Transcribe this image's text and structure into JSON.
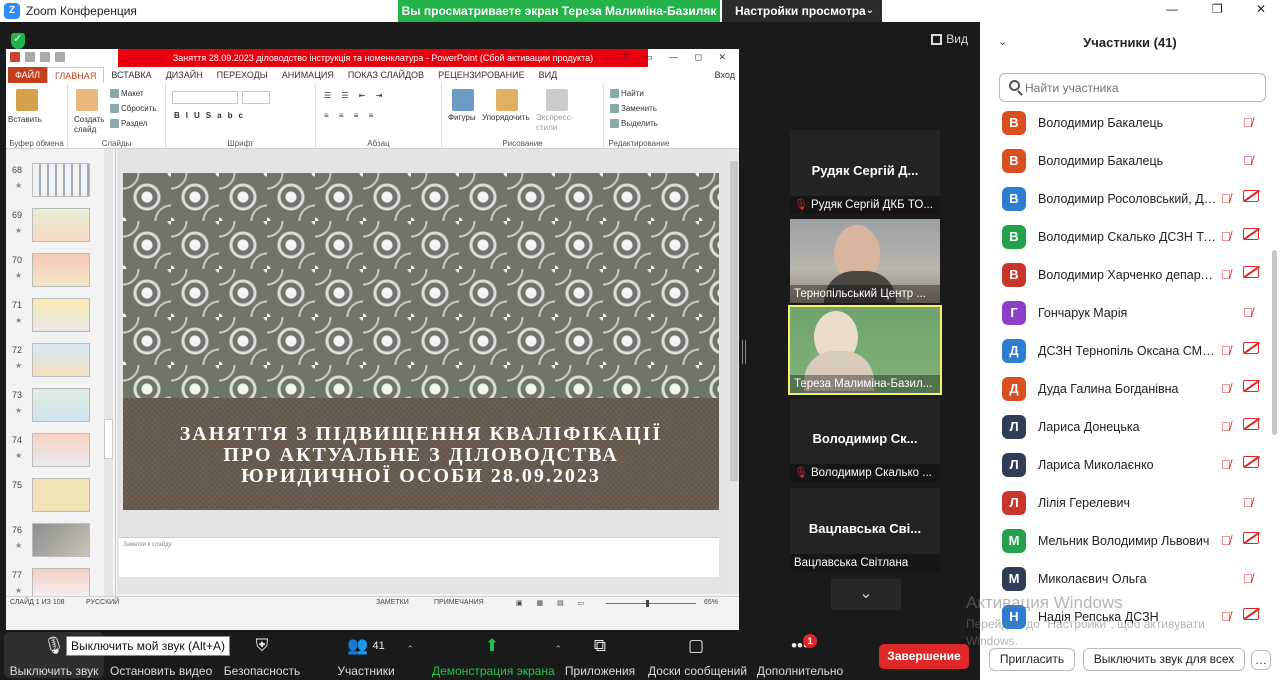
{
  "window": {
    "title": "Zoom Конференция",
    "share_banner": "Вы просматриваете экран Тереза Малиміна-Базиляк",
    "view_options": "Настройки просмотра",
    "view_button": "Вид"
  },
  "ppt": {
    "title": "Заняття 28.09.2023 діловодство інструкція та номенклатура - PowerPoint (Сбой активации продукта)",
    "tabs": [
      "ФАЙЛ",
      "ГЛАВНАЯ",
      "ВСТАВКА",
      "ДИЗАЙН",
      "ПЕРЕХОДЫ",
      "АНИМАЦИЯ",
      "ПОКАЗ СЛАЙДОВ",
      "РЕЦЕНЗИРОВАНИЕ",
      "ВИД"
    ],
    "user": "Вход",
    "ribbon": {
      "paste": "Вставить",
      "clipboard": "Буфер обмена",
      "new_slide": "Создать слайд",
      "layout": "Макет",
      "reset": "Сбросить",
      "section": "Раздел",
      "slides": "Слайды",
      "font": "Шрифт",
      "paragraph": "Абзац",
      "shapes": "Фигуры",
      "arrange": "Упорядочить",
      "quick_styles": "Экспресс-стили",
      "drawing": "Рисование",
      "find": "Найти",
      "replace": "Заменить",
      "select": "Выделить",
      "editing": "Редактирование"
    },
    "thumbnails": [
      "68",
      "69",
      "70",
      "71",
      "72",
      "73",
      "74",
      "75",
      "76",
      "77"
    ],
    "slide_lines": [
      "ЗАНЯТТЯ З ПІДВИЩЕННЯ КВАЛІФІКАЦІЇ",
      "ПРО АКТУАЛЬНЕ З ДІЛОВОДСТВА",
      "ЮРИДИЧНОЇ ОСОБИ 28.09.2023"
    ],
    "notes": "Заметки к слайду",
    "status": {
      "slide": "СЛАЙД 1 ИЗ 108",
      "lang": "РУССКИЙ",
      "notes": "ЗАМЕТКИ",
      "comments": "ПРИМЕЧАНИЯ",
      "zoom": "65%"
    }
  },
  "tiles": [
    {
      "big": "Рудяк Сергій Д...",
      "caption": "Рудяк Сергій ДКБ ТО...",
      "muted": true
    },
    {
      "big": "",
      "caption": "Тернопільський Центр ...",
      "muted": false
    },
    {
      "big": "",
      "caption": "Тереза Малиміна-Базил...",
      "muted": false
    },
    {
      "big": "Володимир Ск...",
      "caption": "Володимир Скалько ...",
      "muted": true
    },
    {
      "big": "Вацлавська Сві...",
      "caption": "Вацлавська Світлана",
      "muted": false
    }
  ],
  "toolbar": {
    "tooltip": "Выключить мой звук (Alt+A)",
    "mute": "Выключить звук",
    "video": "Остановить видео",
    "security": "Безопасность",
    "participants": "Участники",
    "participants_count": "41",
    "share": "Демонстрация экрана",
    "apps": "Приложения",
    "whiteboards": "Доски сообщений",
    "more": "Дополнительно",
    "more_badge": "1",
    "end": "Завершение"
  },
  "panel": {
    "title": "Участники (41)",
    "search_placeholder": "Найти участника",
    "invite": "Пригласить",
    "mute_all": "Выключить звук для всех",
    "participants": [
      {
        "initial": "В",
        "name": "Володимир Бакалець",
        "color": "#d9501e",
        "cam": false
      },
      {
        "initial": "В",
        "name": "Володимир Бакалець",
        "color": "#d9501e",
        "cam": false
      },
      {
        "initial": "В",
        "name": "Володимир Росоловський, ДС...",
        "color": "#2d7dd2",
        "cam": true
      },
      {
        "initial": "В",
        "name": "Володимир Скалько ДСЗН Те...",
        "color": "#23a24d",
        "cam": true
      },
      {
        "initial": "В",
        "name": "Володимир Харченко департа...",
        "color": "#c8352b",
        "cam": true
      },
      {
        "initial": "Г",
        "name": "Гончарук Марія",
        "color": "#8c3fc9",
        "cam": false
      },
      {
        "initial": "Д",
        "name": "ДСЗН Тернопіль Оксана СМО...",
        "color": "#2d7dd2",
        "cam": true
      },
      {
        "initial": "Д",
        "name": "Дуда Галина Богданівна",
        "color": "#d9501e",
        "cam": true
      },
      {
        "initial": "Л",
        "name": "Лариса Донецька",
        "color": "#2f3e56",
        "cam": true
      },
      {
        "initial": "Л",
        "name": "Лариса Миколаєнко",
        "color": "#2f3e56",
        "cam": true
      },
      {
        "initial": "Л",
        "name": "Лілія Герелевич",
        "color": "#c8352b",
        "cam": false
      },
      {
        "initial": "М",
        "name": "Мельник Володимир Львович",
        "color": "#23a24d",
        "cam": true
      },
      {
        "initial": "М",
        "name": "Миколаєвич Ольга",
        "color": "#2f3e56",
        "cam": false
      },
      {
        "initial": "Н",
        "name": "Надія Репська ДСЗН",
        "color": "#2d7dd2",
        "cam": true
      }
    ],
    "activation_title": "Активация Windows",
    "activation_text": "Перейдіть до \"Настройки\", щоб активувати Windows."
  }
}
